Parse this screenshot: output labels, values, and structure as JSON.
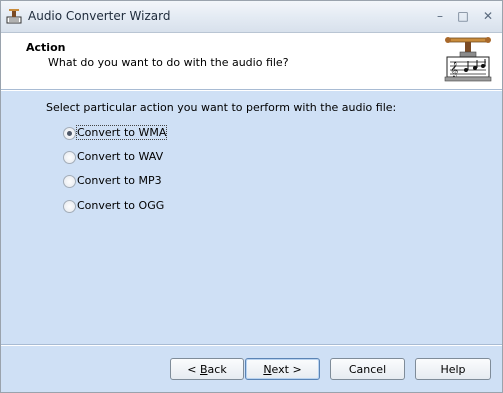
{
  "window": {
    "title": "Audio Converter Wizard",
    "controls": {
      "minimize": "–",
      "maximize": "□",
      "close": "✕"
    }
  },
  "header": {
    "title": "Action",
    "subtitle": "What do you want to do with the audio file?"
  },
  "main": {
    "prompt": "Select particular action you want to perform with the audio file:",
    "options": [
      {
        "label": "Convert to WMA",
        "selected": true
      },
      {
        "label": "Convert to WAV",
        "selected": false
      },
      {
        "label": "Convert to MP3",
        "selected": false
      },
      {
        "label": "Convert to OGG",
        "selected": false
      }
    ]
  },
  "buttons": {
    "back_prefix": "< ",
    "back_mnemonic": "B",
    "back_rest": "ack",
    "next_mnemonic": "N",
    "next_rest": "ext >",
    "cancel": "Cancel",
    "help": "Help"
  },
  "colors": {
    "body_bg": "#cfe0f5",
    "header_bg": "#ffffff",
    "default_button_border": "#5b84b5"
  },
  "icons": {
    "app": "audio-converter-app-icon",
    "header_logo": "music-vise-logo-icon"
  }
}
